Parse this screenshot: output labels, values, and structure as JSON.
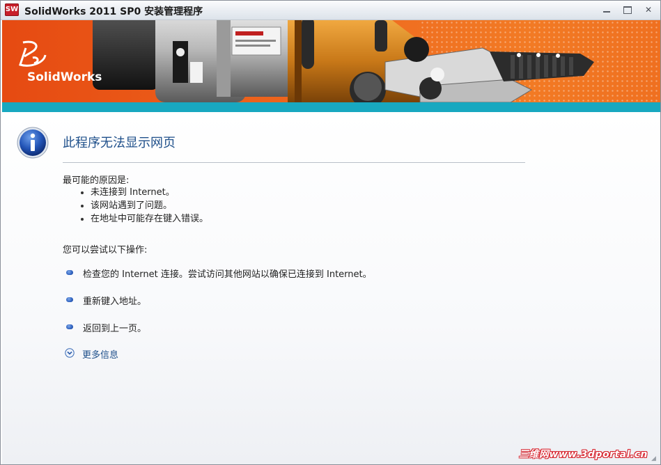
{
  "window": {
    "title": "SolidWorks 2011 SP0 安装管理程序",
    "app_icon_text": "SW",
    "controls": {
      "minimize_icon": "minimize-icon",
      "maximize_icon": "maximize-icon",
      "close_label": "✕"
    }
  },
  "banner": {
    "logo_text": "SolidWorks",
    "colors": {
      "orange": "#ef6c20",
      "teal": "#18a8c0"
    }
  },
  "error_page": {
    "title": "此程序无法显示网页",
    "reason_heading": "最可能的原因是:",
    "reasons": [
      "未连接到 Internet。",
      "该网站遇到了问题。",
      "在地址中可能存在键入错误。"
    ],
    "try_heading": "您可以尝试以下操作:",
    "actions": [
      "检查您的 Internet 连接。尝试访问其他网站以确保已连接到 Internet。",
      "重新键入地址。",
      "返回到上一页。"
    ],
    "more_info": "更多信息",
    "title_color": "#1e4f8a"
  },
  "watermark": "三维网www.3dportal.cn"
}
